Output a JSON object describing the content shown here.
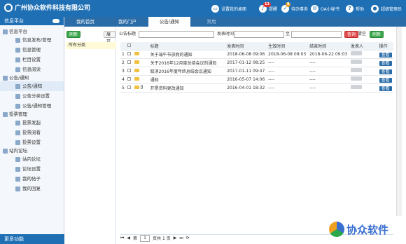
{
  "header": {
    "logo_text": "广州协众软件科技有限公司",
    "items": [
      {
        "label": "设置我的桌面",
        "icon": "desktop-icon"
      },
      {
        "label": "提醒",
        "icon": "bell-icon",
        "badge": "13"
      },
      {
        "label": "待办事务",
        "icon": "task-icon",
        "badge": "8"
      },
      {
        "label": "OA小秘书",
        "icon": "chat-icon"
      },
      {
        "label": "帮助",
        "icon": "help-icon"
      },
      {
        "label": "超级管理员",
        "icon": "user-icon"
      }
    ]
  },
  "sidebar": {
    "title": "信息平台",
    "footer": "更多功能",
    "groups": [
      {
        "label": "信息平台",
        "items": [
          "信息发布/管理",
          "信息管理",
          "栏目设置",
          "信息阅读"
        ]
      },
      {
        "label": "公告/通知",
        "items": [
          "公告/通知",
          "公告分类设置",
          "公告/通知管理"
        ]
      },
      {
        "label": "投票管理",
        "items": [
          "投票发起",
          "投票阅看",
          "投票设置"
        ]
      },
      {
        "label": "站内论坛",
        "items": [
          "站内论坛",
          "论坛设置",
          "我的帖子",
          "我的回复"
        ]
      }
    ]
  },
  "tabs": [
    "我的首页",
    "我的门户",
    "公告/通知",
    "常用"
  ],
  "left_pane": {
    "refresh": "刷新",
    "expand": "展开",
    "category": "所有分类"
  },
  "filters": {
    "title_label": "公告标题",
    "time_label": "发表时间",
    "to_label": "至",
    "query": "查询",
    "clear": "清空",
    "refresh": "刷新"
  },
  "table": {
    "headers": [
      "标题",
      "发表时间",
      "生效时间",
      "结束时间",
      "发表人",
      "操作"
    ],
    "rows": [
      {
        "no": "1",
        "title": "关于端午节放假的通知",
        "pub": "2018-06-08 09:06",
        "eff": "2018-06-08 09:03",
        "end": "2018-06-22 09:03",
        "op": "查看"
      },
      {
        "no": "2",
        "title": "关于2016年12月度总结会议的通知",
        "pub": "2017-01-12 08:25",
        "eff": "----",
        "end": "----",
        "op": "查看"
      },
      {
        "no": "3",
        "title": "取消2016年度年终总结会议通知",
        "pub": "2017-01-11 09:47",
        "eff": "----",
        "end": "----",
        "op": "查看"
      },
      {
        "no": "4",
        "title": "通知",
        "pub": "2016-05-07 14:06",
        "eff": "----",
        "end": "----",
        "op": "查看"
      },
      {
        "no": "5",
        "title": "开票资料更改通知",
        "pub": "2016-04-01 18:32",
        "eff": "----",
        "end": "----",
        "op": "查看"
      }
    ]
  },
  "pager": {
    "page_label": "第",
    "page_value": "1",
    "total": "页共 1 页"
  },
  "brand": "协众软件"
}
